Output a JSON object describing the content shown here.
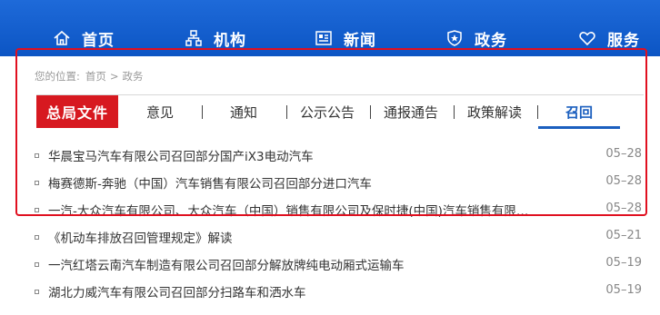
{
  "nav": {
    "items": [
      {
        "label": "首页",
        "icon": "home-icon"
      },
      {
        "label": "机构",
        "icon": "org-chart-icon"
      },
      {
        "label": "新闻",
        "icon": "newspaper-icon"
      },
      {
        "label": "政务",
        "icon": "shield-star-icon"
      },
      {
        "label": "服务",
        "icon": "heart-icon"
      }
    ]
  },
  "breadcrumb": {
    "prefix": "您的位置:",
    "home": "首页",
    "separator": ">",
    "current": "政务"
  },
  "tabs": {
    "active_label": "总局文件",
    "items": [
      "意见",
      "通知",
      "公示公告",
      "通报通告",
      "政策解读",
      "召回"
    ],
    "current": "召回"
  },
  "list": [
    {
      "title": "华晨宝马汽车有限公司召回部分国产iX3电动汽车",
      "date": "05–28"
    },
    {
      "title": "梅赛德斯-奔驰（中国）汽车销售有限公司召回部分进口汽车",
      "date": "05–28"
    },
    {
      "title": "一汽-大众汽车有限公司、大众汽车（中国）销售有限公司及保时捷(中国)汽车销售有限公司召回部分汽车",
      "date": "05–28"
    },
    {
      "title": "《机动车排放召回管理规定》解读",
      "date": "05–21"
    },
    {
      "title": "一汽红塔云南汽车制造有限公司召回部分解放牌纯电动厢式运输车",
      "date": "05–19"
    },
    {
      "title": "湖北力威汽车有限公司召回部分扫路车和洒水车",
      "date": "05–19"
    }
  ],
  "colors": {
    "nav_blue": "#1463d3",
    "accent_red": "#d71920",
    "link_blue": "#1b5fbf"
  }
}
